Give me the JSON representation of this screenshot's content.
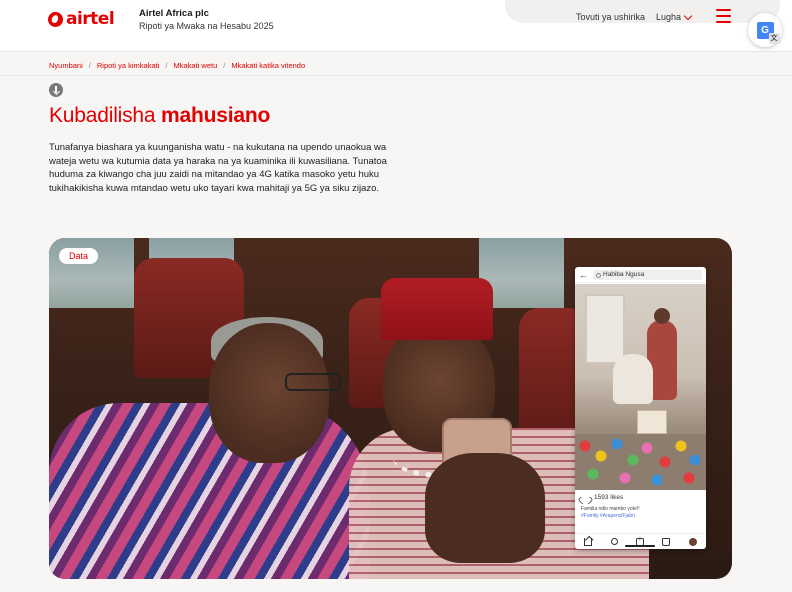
{
  "header": {
    "logo_text": "airtel",
    "company_name": "Airtel Africa plc",
    "report_title": "Ripoti ya Mwaka na Hesabu 2025",
    "nav_investors": "Tovuti ya ushirika",
    "nav_language": "Lugha",
    "menu_icon": "hamburger-icon",
    "translate_icon": "google-translate-icon",
    "accent_color": "#e40000"
  },
  "breadcrumb": {
    "items": [
      "Nyumbani",
      "Ripoti ya kimkakati",
      "Mkakati wetu",
      "Mkakati katika vitendo"
    ],
    "separator": "/"
  },
  "page": {
    "title_regular": "Kubadilisha ",
    "title_bold": "mahusiano",
    "intro": "Tunafanya biashara ya kuunganisha watu - na kukutana na upendo unaokua wa wateja wetu wa kutumia data ya haraka na ya kuaminika ili kuwasiliana. Tunatoa huduma za kiwango cha juu zaidi na mitandao ya 4G katika masoko yetu huku tukihakikisha kuwa mtandao wetu uko tayari kwa mahitaji ya 5G ya siku zijazo."
  },
  "hero": {
    "tag": "Data",
    "phone": {
      "profile_name": "Habiba Ngusa",
      "likes": "1593 likes",
      "caption": "Familia ndio mambo yote!!",
      "hashtags": "#Family #ArapenziFjabri"
    }
  }
}
